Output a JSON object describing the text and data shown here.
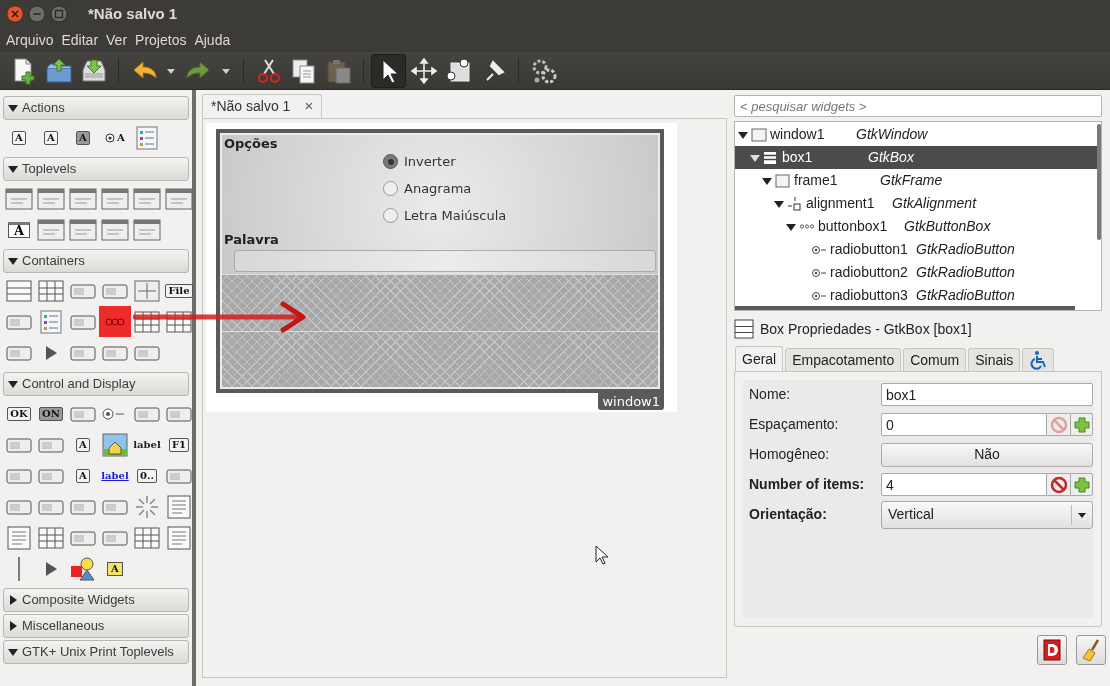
{
  "window": {
    "title": "*Não salvo 1"
  },
  "menu": [
    "Arquivo",
    "Editar",
    "Ver",
    "Projetos",
    "Ajuda"
  ],
  "toolbar": [
    {
      "kind": "new",
      "disabled": false
    },
    {
      "kind": "open",
      "disabled": false
    },
    {
      "kind": "save",
      "disabled": false
    },
    {
      "kind": "separator"
    },
    {
      "kind": "undo",
      "disabled": false
    },
    {
      "kind": "menu-arrow",
      "disabled": false
    },
    {
      "kind": "redo",
      "disabled": false
    },
    {
      "kind": "menu-arrow",
      "disabled": false
    },
    {
      "kind": "separator"
    },
    {
      "kind": "cut",
      "disabled": false
    },
    {
      "kind": "copy",
      "disabled": false
    },
    {
      "kind": "paste",
      "disabled": true
    },
    {
      "kind": "separator"
    },
    {
      "kind": "pointer",
      "disabled": false,
      "selected": true
    },
    {
      "kind": "move",
      "disabled": false,
      "selected": false
    },
    {
      "kind": "resize",
      "disabled": false,
      "selected": false
    },
    {
      "kind": "pin",
      "disabled": false,
      "selected": false
    },
    {
      "kind": "separator"
    },
    {
      "kind": "gears",
      "disabled": false
    }
  ],
  "palette": [
    {
      "label": "Actions",
      "expanded": true,
      "items": [
        {
          "kind": "textbox",
          "text": "A",
          "selected": false
        },
        {
          "kind": "textbox",
          "text": "A",
          "selected": false
        },
        {
          "kind": "toggle",
          "text": "A",
          "selected": false
        },
        {
          "kind": "radio",
          "text": "A",
          "selected": false
        },
        {
          "kind": "list",
          "selected": false
        }
      ]
    },
    {
      "label": "Toplevels",
      "expanded": true,
      "items": [
        {
          "kind": "window",
          "selected": false
        },
        {
          "kind": "window",
          "selected": false
        },
        {
          "kind": "window",
          "selected": false
        },
        {
          "kind": "window",
          "selected": false
        },
        {
          "kind": "window",
          "selected": false
        },
        {
          "kind": "window",
          "selected": false
        },
        {
          "kind": "window",
          "text": "A",
          "selected": false
        },
        {
          "kind": "window",
          "selected": false
        },
        {
          "kind": "window",
          "selected": false
        },
        {
          "kind": "window",
          "selected": false
        },
        {
          "kind": "window",
          "selected": false
        }
      ]
    },
    {
      "label": "Containers",
      "expanded": true,
      "items": [
        {
          "kind": "box",
          "selected": false
        },
        {
          "kind": "grid",
          "selected": false
        },
        {
          "kind": "widget",
          "selected": false
        },
        {
          "kind": "widget",
          "selected": false
        },
        {
          "kind": "move",
          "selected": false
        },
        {
          "kind": "textbox",
          "text": "File",
          "selected": false
        },
        {
          "kind": "widget",
          "selected": false
        },
        {
          "kind": "list",
          "selected": false
        },
        {
          "kind": "widget",
          "selected": false
        },
        {
          "kind": "dots",
          "selected": true
        },
        {
          "kind": "grid",
          "selected": false
        },
        {
          "kind": "grid",
          "selected": false
        },
        {
          "kind": "widget",
          "selected": false
        },
        {
          "kind": "arrow",
          "selected": false
        },
        {
          "kind": "widget",
          "selected": false
        },
        {
          "kind": "widget",
          "selected": false
        },
        {
          "kind": "widget",
          "selected": false
        }
      ]
    },
    {
      "label": "Control and Display",
      "expanded": true,
      "items": [
        {
          "kind": "textbox",
          "text": "OK",
          "selected": false
        },
        {
          "kind": "toggle",
          "text": "ON",
          "selected": false
        },
        {
          "kind": "widget",
          "selected": false
        },
        {
          "kind": "radio",
          "selected": false
        },
        {
          "kind": "widget",
          "selected": false
        },
        {
          "kind": "widget",
          "selected": false
        },
        {
          "kind": "widget",
          "selected": false
        },
        {
          "kind": "widget",
          "selected": false
        },
        {
          "kind": "textbox",
          "text": "A",
          "selected": false
        },
        {
          "kind": "image",
          "selected": false
        },
        {
          "kind": "label",
          "text": "label",
          "selected": false
        },
        {
          "kind": "textbox",
          "text": "F1",
          "selected": false
        },
        {
          "kind": "widget",
          "selected": false
        },
        {
          "kind": "widget",
          "selected": false
        },
        {
          "kind": "textbox",
          "text": "A",
          "selected": false
        },
        {
          "kind": "link",
          "text": "label",
          "selected": false
        },
        {
          "kind": "textbox",
          "text": "0..",
          "selected": false
        },
        {
          "kind": "widget",
          "selected": false
        },
        {
          "kind": "widget",
          "selected": false
        },
        {
          "kind": "widget",
          "selected": false
        },
        {
          "kind": "widget",
          "selected": false
        },
        {
          "kind": "widget",
          "selected": false
        },
        {
          "kind": "spinner",
          "selected": false
        },
        {
          "kind": "lines",
          "selected": false
        },
        {
          "kind": "lines",
          "selected": false
        },
        {
          "kind": "grid",
          "selected": false
        },
        {
          "kind": "widget",
          "selected": false
        },
        {
          "kind": "widget",
          "selected": false
        },
        {
          "kind": "grid",
          "selected": false
        },
        {
          "kind": "lines",
          "selected": false
        },
        {
          "kind": "separator",
          "selected": false
        },
        {
          "kind": "arrow",
          "selected": false
        },
        {
          "kind": "shapes",
          "selected": false
        },
        {
          "kind": "note",
          "text": "A",
          "selected": false
        }
      ]
    },
    {
      "label": "Composite Widgets",
      "expanded": false
    },
    {
      "label": "Miscellaneous",
      "expanded": false
    },
    {
      "label": "GTK+ Unix Print Toplevels",
      "expanded": true
    }
  ],
  "document_tab": {
    "label": "*Não salvo 1",
    "close": "×"
  },
  "design_window": {
    "frame_label": "Opções",
    "radios": [
      {
        "label": "Inverter",
        "selected": true
      },
      {
        "label": "Anagrama",
        "selected": false
      },
      {
        "label": "Letra Maiúscula",
        "selected": false
      }
    ],
    "entry_label": "Palavra",
    "empty_slots": [
      {
        "kind": "placeholder"
      },
      {
        "kind": "placeholder"
      }
    ],
    "name_tag": "window1"
  },
  "inspector": {
    "search": {
      "placeholder": "< pesquisar widgets >"
    },
    "tree": [
      {
        "name": "window1",
        "type": "GtkWindow",
        "kind": "window",
        "expanded": true,
        "selected": false,
        "children": [
          {
            "name": "box1",
            "type": "GtkBox",
            "kind": "box",
            "expanded": true,
            "selected": true,
            "children": [
              {
                "name": "frame1",
                "type": "GtkFrame",
                "kind": "frame",
                "expanded": true,
                "selected": false,
                "children": [
                  {
                    "name": "alignment1",
                    "type": "GtkAlignment",
                    "kind": "alignment",
                    "expanded": true,
                    "selected": false,
                    "children": [
                      {
                        "name": "buttonbox1",
                        "type": "GtkButtonBox",
                        "kind": "buttonbox",
                        "expanded": true,
                        "selected": false,
                        "children": [
                          {
                            "name": "radiobutton1",
                            "type": "GtkRadioButton",
                            "kind": "radio",
                            "selected": false
                          },
                          {
                            "name": "radiobutton2",
                            "type": "GtkRadioButton",
                            "kind": "radio",
                            "selected": false
                          },
                          {
                            "name": "radiobutton3",
                            "type": "GtkRadioButton",
                            "kind": "radio",
                            "selected": false
                          }
                        ]
                      }
                    ]
                  }
                ]
              }
            ]
          }
        ]
      }
    ]
  },
  "properties": {
    "title": "Box Propriedades - GtkBox [box1]",
    "tabs": [
      {
        "kind": "text",
        "label": "Geral",
        "selected": true
      },
      {
        "kind": "text",
        "label": "Empacotamento",
        "selected": false
      },
      {
        "kind": "text",
        "label": "Comum",
        "selected": false
      },
      {
        "kind": "text",
        "label": "Sinais",
        "selected": false
      },
      {
        "kind": "accessibility",
        "selected": false
      }
    ],
    "fields": [
      {
        "label": "Nome:",
        "kind": "entry",
        "value": "box1",
        "bold": false
      },
      {
        "label": "Espaçamento:",
        "kind": "spin",
        "value": "0",
        "bold": false,
        "reset_enabled": false
      },
      {
        "label": "Homogêneo:",
        "kind": "toggle",
        "value": "Não",
        "bold": false
      },
      {
        "label": "Number of items:",
        "kind": "spin",
        "value": "4",
        "bold": true,
        "reset_enabled": true
      },
      {
        "label": "Orientação:",
        "kind": "combo",
        "value": "Vertical",
        "bold": true
      }
    ]
  }
}
